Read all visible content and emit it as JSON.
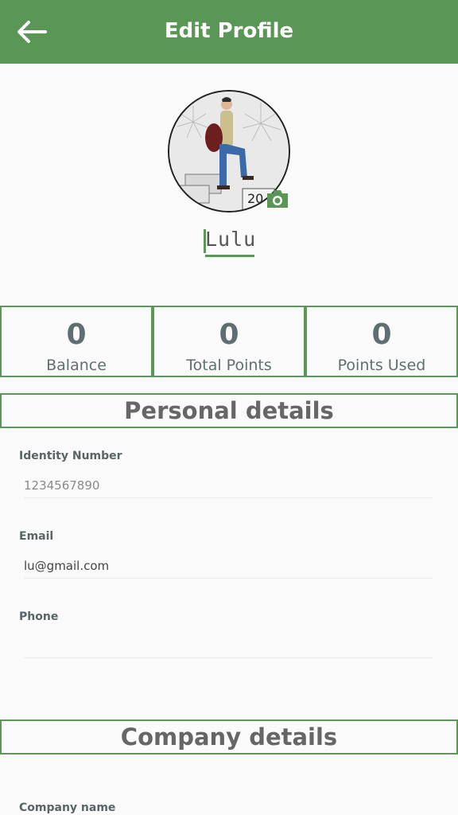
{
  "header": {
    "title": "Edit Profile",
    "background_color": "#5a9655",
    "back_icon": "arrow-left-icon"
  },
  "profile": {
    "username": "Lulu",
    "avatar_icon": "profile-photo",
    "camera_icon": "camera-icon",
    "accent_color": "#5a9655"
  },
  "stats": [
    {
      "value": "0",
      "label": "Balance"
    },
    {
      "value": "0",
      "label": "Total Points"
    },
    {
      "value": "0",
      "label": "Points Used"
    }
  ],
  "personal": {
    "title": "Personal details",
    "fields": [
      {
        "label": "Identity Number",
        "value": "",
        "placeholder": "1234567890"
      },
      {
        "label": "Email",
        "value": "lu@gmail.com",
        "placeholder": ""
      },
      {
        "label": "Phone",
        "value": "",
        "placeholder": ""
      }
    ]
  },
  "company": {
    "title": "Company details",
    "fields": [
      {
        "label": "Company name"
      }
    ]
  }
}
